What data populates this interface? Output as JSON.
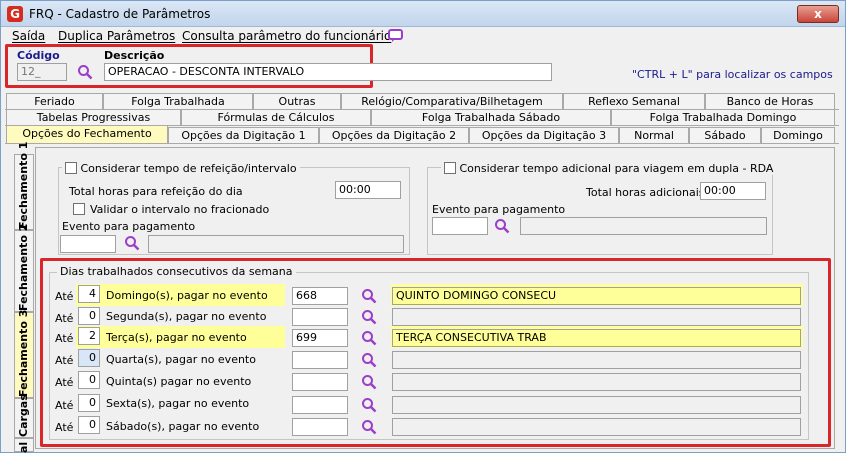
{
  "window": {
    "title": "FRQ - Cadastro de Parâmetros",
    "close": "x"
  },
  "menu": [
    "Saída",
    "Duplica Parâmetros",
    "Consulta parâmetro do funcionário"
  ],
  "header": {
    "codigo_label": "Código",
    "codigo_value": "12_",
    "descricao_label": "Descrição",
    "descricao_value": "OPERACAO - DESCONTA INTERVALO",
    "hint": "\"CTRL + L\" para localizar os campos"
  },
  "tabs_row1": [
    "Feriado",
    "Folga Trabalhada",
    "Outras",
    "Relógio/Comparativa/Bilhetagem",
    "Reflexo Semanal",
    "Banco de Horas"
  ],
  "tabs_row2": [
    "Tabelas Progressivas",
    "Fórmulas de Cálculos",
    "Folga Trabalhada Sábado",
    "Folga Trabalhada Domingo"
  ],
  "tabs_row3": [
    "Opções do Fechamento",
    "Opções da Digitação 1",
    "Opções da Digitação 2",
    "Opções da Digitação 3",
    "Normal",
    "Sábado",
    "Domingo"
  ],
  "side_tabs": [
    "Fechamento 1",
    "Fechamento 2",
    "Fechamento 3",
    "Cargas",
    "al"
  ],
  "refeicao": {
    "check_label": "Considerar tempo de refeição/intervalo",
    "total_label": "Total horas para refeição do dia",
    "total_value": "00:00",
    "validar_label": "Validar o intervalo no fracionado",
    "evento_label": "Evento para pagamento"
  },
  "rda": {
    "check_label": "Considerar tempo adicional para viagem em dupla - RDA",
    "total_label": "Total horas adicionais",
    "total_value": "00:00",
    "evento_label": "Evento para pagamento"
  },
  "dias": {
    "title": "Dias trabalhados consecutivos da semana",
    "ate": "Até",
    "rows": [
      {
        "count": "4",
        "label": "Domingo(s), pagar no evento",
        "event": "668",
        "desc": "QUINTO DOMINGO CONSECU"
      },
      {
        "count": "0",
        "label": "Segunda(s),  pagar no evento",
        "event": "",
        "desc": ""
      },
      {
        "count": "2",
        "label": "Terça(s), pagar no evento",
        "event": "699",
        "desc": "TERÇA CONSECUTIVA TRAB"
      },
      {
        "count": "0",
        "label": "Quarta(s), pagar no evento",
        "event": "",
        "desc": ""
      },
      {
        "count": "0",
        "label": "Quinta(s) pagar no evento",
        "event": "",
        "desc": ""
      },
      {
        "count": "0",
        "label": "Sexta(s), pagar no evento",
        "event": "",
        "desc": ""
      },
      {
        "count": "0",
        "label": "Sábado(s), pagar no evento",
        "event": "",
        "desc": ""
      }
    ]
  }
}
